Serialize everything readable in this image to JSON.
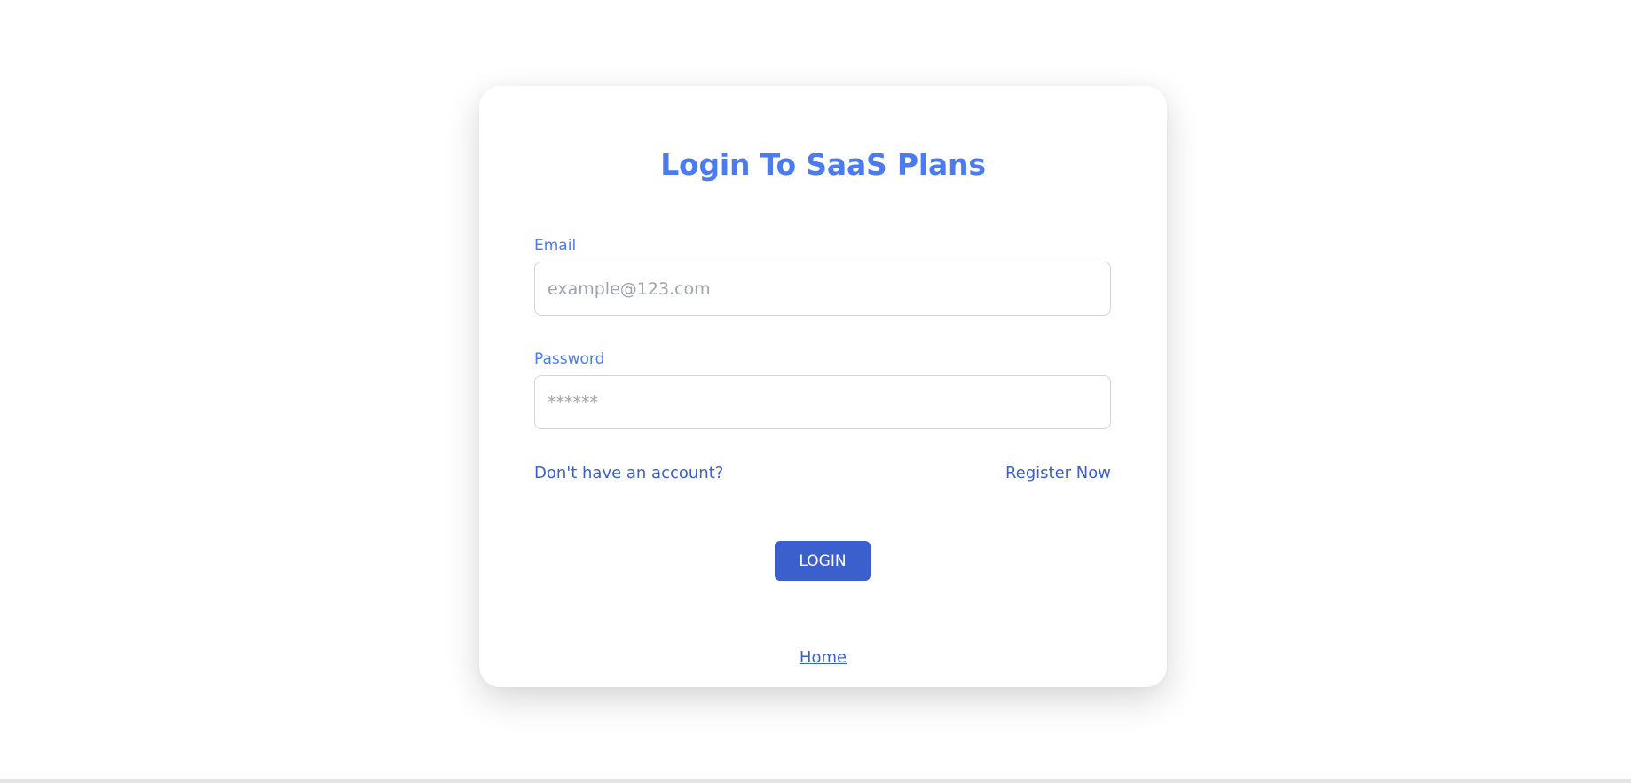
{
  "login": {
    "title": "Login To SaaS Plans",
    "email_label": "Email",
    "email_placeholder": "example@123.com",
    "email_value": "",
    "password_label": "Password",
    "password_placeholder": "******",
    "password_value": "",
    "no_account_text": "Don't have an account?",
    "register_link": "Register Now",
    "login_button": "LOGIN",
    "home_link": "Home"
  },
  "colors": {
    "accent": "#4a7bf0",
    "primary": "#3b5fcc",
    "input_border": "#d3d5db"
  }
}
